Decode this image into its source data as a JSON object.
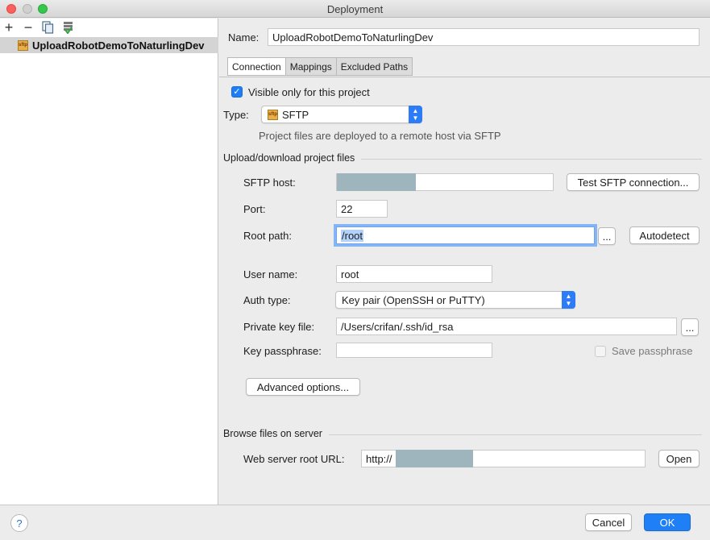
{
  "window": {
    "title": "Deployment"
  },
  "toolbar": {
    "add": "+",
    "remove": "−"
  },
  "servers": [
    {
      "name": "UploadRobotDemoToNaturlingDev",
      "icon": "sftp-server-icon",
      "icon_text": "sftp"
    }
  ],
  "form": {
    "name_label": "Name:",
    "name_value": "UploadRobotDemoToNaturlingDev",
    "tabs": [
      "Connection",
      "Mappings",
      "Excluded Paths"
    ],
    "active_tab": "Connection",
    "visible_only": {
      "label": "Visible only for this project",
      "checked": true
    },
    "type": {
      "label": "Type:",
      "value": "SFTP",
      "description": "Project files are deployed to a remote host via SFTP"
    },
    "upload_section": "Upload/download project files",
    "sftp_host": {
      "label": "SFTP host:",
      "value": "",
      "test_button": "Test SFTP connection..."
    },
    "port": {
      "label": "Port:",
      "value": "22"
    },
    "root_path": {
      "label": "Root path:",
      "value": "/root",
      "browse_button": "...",
      "autodetect_button": "Autodetect"
    },
    "user_name": {
      "label": "User name:",
      "value": "root"
    },
    "auth_type": {
      "label": "Auth type:",
      "value": "Key pair (OpenSSH or PuTTY)"
    },
    "private_key": {
      "label": "Private key file:",
      "value": "/Users/crifan/.ssh/id_rsa",
      "browse_button": "..."
    },
    "key_passphrase": {
      "label": "Key passphrase:",
      "value": "",
      "save_label": "Save passphrase",
      "save_checked": false
    },
    "advanced_button": "Advanced options...",
    "browse_section": "Browse files on server",
    "web_url": {
      "label": "Web server root URL:",
      "value": "http://",
      "open_button": "Open"
    }
  },
  "footer": {
    "help": "?",
    "cancel": "Cancel",
    "ok": "OK"
  },
  "colors": {
    "accent": "#1e7ff6",
    "masked": "#9fb5be",
    "selection": "#d4d4d4"
  }
}
